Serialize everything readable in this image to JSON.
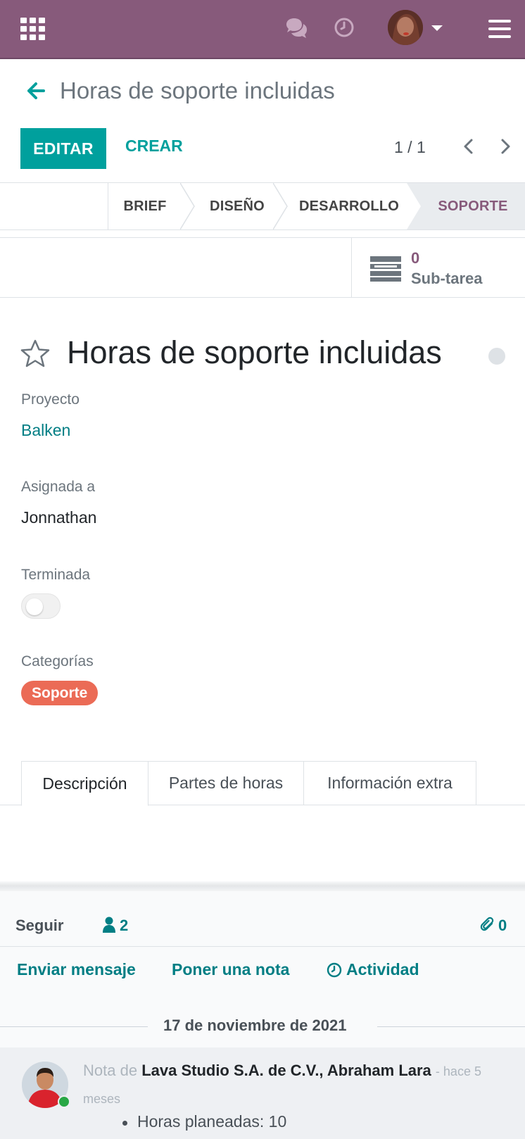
{
  "colors": {
    "navbar": "#875a7b",
    "primary": "#00a09d",
    "link": "#017e84",
    "tag_soporte": "#eb6b56",
    "stage_active_text": "#875a7b"
  },
  "navbar": {
    "icons": [
      "apps-grid-icon",
      "chat-icon",
      "clock-icon",
      "user-avatar",
      "caret-down-icon",
      "hamburger-menu-icon"
    ]
  },
  "breadcrumb": {
    "title": "Horas de soporte incluidas"
  },
  "controls": {
    "edit_label": "EDITAR",
    "create_label": "CREAR",
    "pager_value": "1 / 1"
  },
  "stages": [
    {
      "label": "BRIEF",
      "active": false
    },
    {
      "label": "DISEÑO",
      "active": false
    },
    {
      "label": "DESARROLLO",
      "active": false
    },
    {
      "label": "SOPORTE",
      "active": true
    }
  ],
  "buttonbox": {
    "subtask_count": "0",
    "subtask_label": "Sub-tarea"
  },
  "form": {
    "name": "Horas de soporte incluidas",
    "project_label": "Proyecto",
    "project_value": "Balken",
    "assigned_label": "Asignada a",
    "assigned_value": "Jonnathan",
    "done_label": "Terminada",
    "done_value": false,
    "categories_label": "Categorías",
    "category_tag": "Soporte"
  },
  "tabs": [
    {
      "label": "Descripción",
      "active": true
    },
    {
      "label": "Partes de horas",
      "active": false
    },
    {
      "label": "Información extra",
      "active": false
    }
  ],
  "chatter": {
    "follow_label": "Seguir",
    "followers_count": "2",
    "attachments_count": "0",
    "send_message": "Enviar mensaje",
    "log_note": "Poner una nota",
    "activity": "Actividad",
    "date_separator": "17 de noviembre de 2021",
    "message": {
      "prefix": "Nota de",
      "author": "Lava Studio S.A. de C.V., Abraham Lara",
      "date": "- hace 5 meses",
      "body": "Horas planeadas: 10"
    }
  }
}
